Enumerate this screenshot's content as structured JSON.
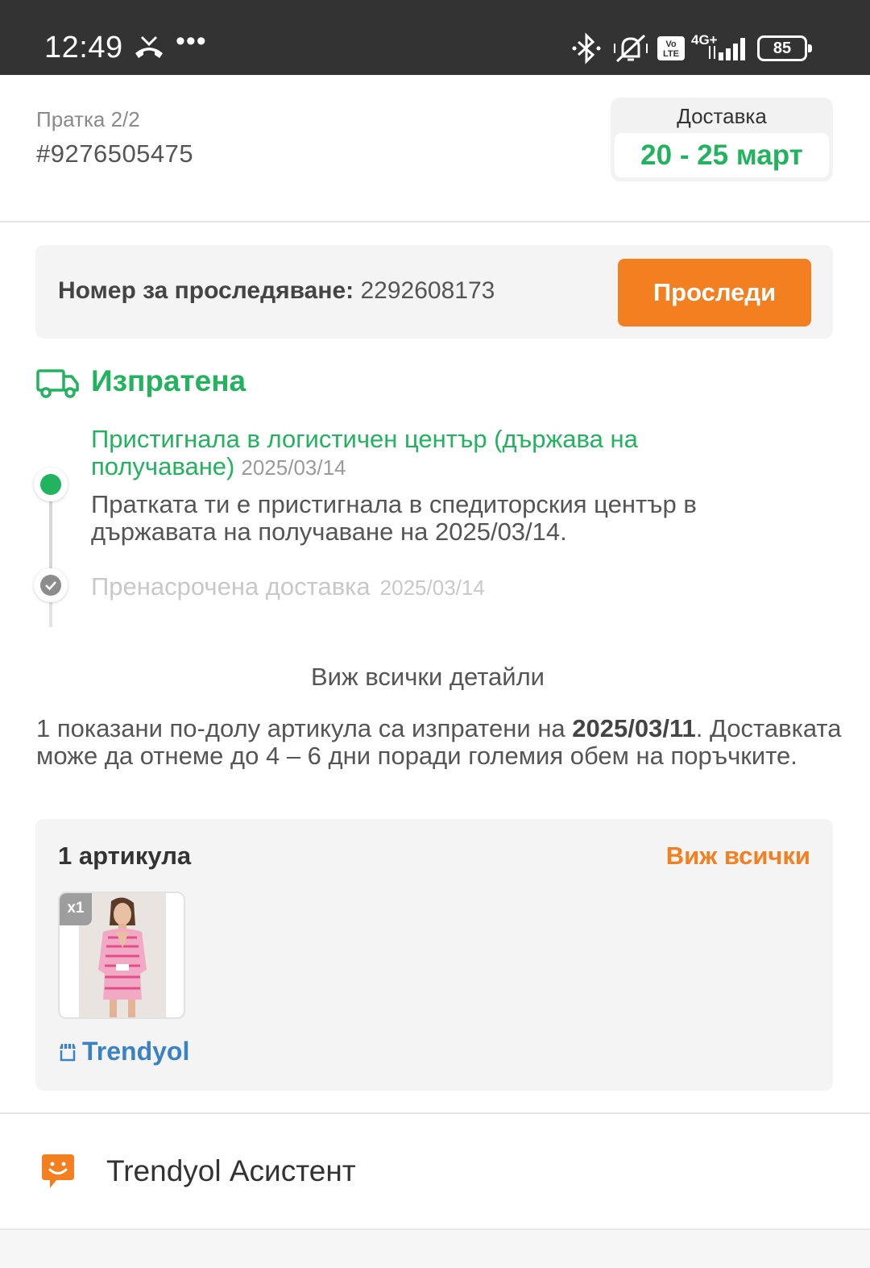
{
  "status_bar": {
    "time": "12:49",
    "dots": "•••",
    "volte_line1": "Vo",
    "volte_line2": "LTE",
    "network": "4G+",
    "battery": "85"
  },
  "package": {
    "label": "Пратка 2/2",
    "number": "#9276505475"
  },
  "delivery": {
    "label": "Доставка",
    "range": "20 - 25 март"
  },
  "tracking": {
    "label": "Номер за проследяване:",
    "number": "2292608173",
    "button": "Проследи"
  },
  "status": {
    "title": "Изпратена",
    "icon": "truck-icon"
  },
  "timeline": [
    {
      "title": "Пристигнала в логистичен център (държава на получаване)",
      "date": "2025/03/14",
      "description": "Пратката ти е пристигнала в спедиторския център в държавата на получаване на 2025/03/14."
    },
    {
      "title": "Пренасрочена доставка",
      "date": "2025/03/14"
    }
  ],
  "see_details": "Виж всички детайли",
  "shipped_note": {
    "before": "1 показани по-долу артикула са изпратени на ",
    "date": "2025/03/11",
    "after": ". Доставката може да отнеме до 4 – 6 дни поради големия обем на поръчките."
  },
  "items": {
    "count_label": "1 артикула",
    "view_all": "Виж всички",
    "quantity": "x1",
    "store": "Trendyol"
  },
  "assistant": {
    "label": "Trendyol Асистент"
  },
  "colors": {
    "green": "#21b35d",
    "orange": "#f47f20",
    "link_blue": "#3b82c4",
    "status_bar": "#333333"
  }
}
